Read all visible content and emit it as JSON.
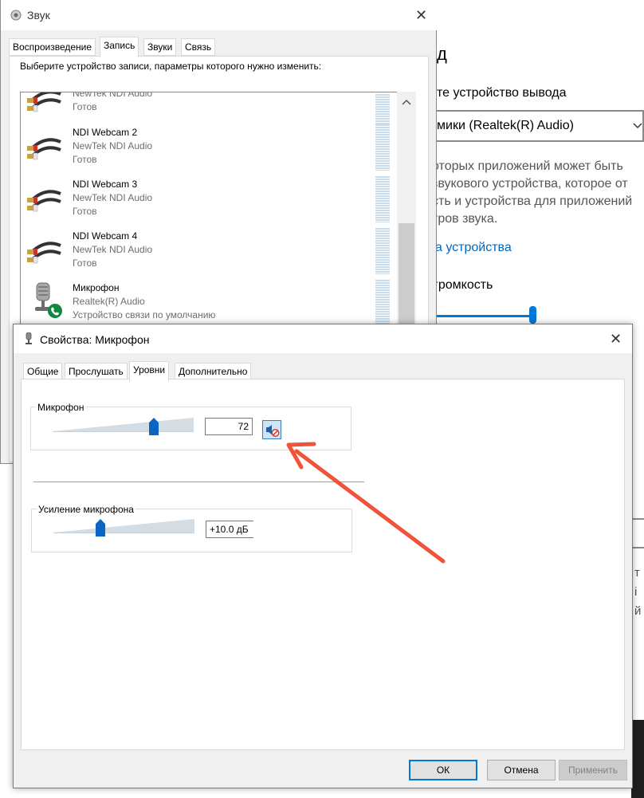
{
  "settings_bg": {
    "heading_partial": "д",
    "output_device_label": "те устройство вывода",
    "output_device_value": "мики (Realtek(R) Audio)",
    "desc_line1": "оторых приложений может быть",
    "desc_line2": "звукового устройства, которое от",
    "desc_line3": "сть и устройства для приложений",
    "desc_line4": "тров звука.",
    "link": "а устройства",
    "volume_label": "громкость",
    "right_text_1": "т",
    "right_text_2": "і",
    "right_text_3": "й"
  },
  "sound_window": {
    "title": "Звук",
    "tabs": [
      "Воспроизведение",
      "Запись",
      "Звуки",
      "Связь"
    ],
    "instruction": "Выберите устройство записи, параметры которого нужно изменить:",
    "devices": [
      {
        "name": "",
        "sub": "NewTek NDI Audio",
        "status": "Готов"
      },
      {
        "name": "NDI Webcam 2",
        "sub": "NewTek NDI Audio",
        "status": "Готов"
      },
      {
        "name": "NDI Webcam 3",
        "sub": "NewTek NDI Audio",
        "status": "Готов"
      },
      {
        "name": "NDI Webcam 4",
        "sub": "NewTek NDI Audio",
        "status": "Готов"
      },
      {
        "name": "Микрофон",
        "sub": "Realtek(R) Audio",
        "status": "Устройство связи по умолчанию"
      }
    ]
  },
  "props_window": {
    "title": "Свойства: Микрофон",
    "tabs": [
      "Общие",
      "Прослушать",
      "Уровни",
      "Дополнительно"
    ],
    "mic_group_label": "Микрофон",
    "mic_level": "72",
    "mic_level_fraction": 0.72,
    "boost_group_label": "Усиление микрофона",
    "boost_value": "+10.0 дБ",
    "boost_fraction": 0.333,
    "buttons": {
      "ok": "ОК",
      "cancel": "Отмена",
      "apply": "Применить"
    }
  },
  "colors": {
    "accent": "#0078d7",
    "arrow": "#f0533a",
    "link": "#0067c0"
  }
}
